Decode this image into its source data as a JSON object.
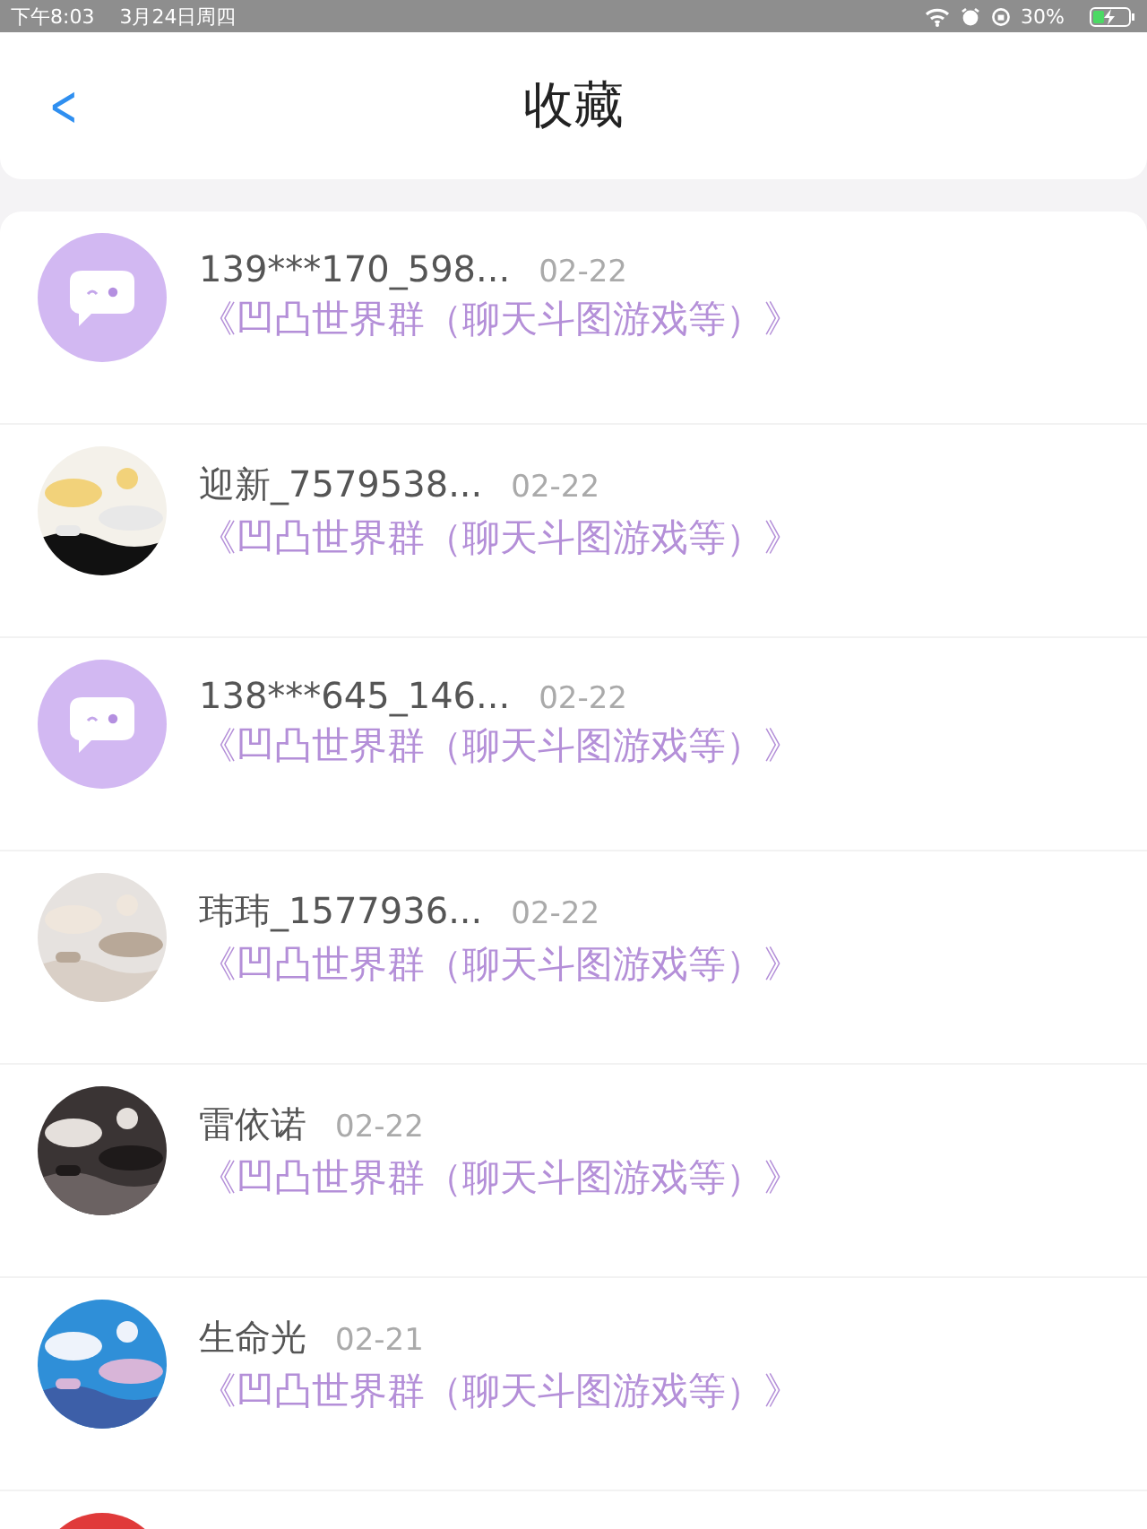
{
  "status_bar": {
    "time": "下午8:03",
    "date": "3月24日周四",
    "battery": "30%"
  },
  "header": {
    "back": "<",
    "title": "收藏"
  },
  "items": [
    {
      "kind": "default",
      "name": "139***170_598...",
      "date": "02-22",
      "group": "《凹凸世界群（聊天斗图游戏等）》"
    },
    {
      "kind": "picture",
      "name": "迎新_7579538...",
      "date": "02-22",
      "group": "《凹凸世界群（聊天斗图游戏等）》"
    },
    {
      "kind": "default",
      "name": "138***645_146...",
      "date": "02-22",
      "group": "《凹凸世界群（聊天斗图游戏等）》"
    },
    {
      "kind": "picture",
      "name": "玮玮_1577936...",
      "date": "02-22",
      "group": "《凹凸世界群（聊天斗图游戏等）》"
    },
    {
      "kind": "picture",
      "name": "雷依诺",
      "date": "02-22",
      "group": "《凹凸世界群（聊天斗图游戏等）》"
    },
    {
      "kind": "picture",
      "name": "生命光",
      "date": "02-21",
      "group": "《凹凸世界群（聊天斗图游戏等）》"
    },
    {
      "kind": "picture"
    }
  ]
}
